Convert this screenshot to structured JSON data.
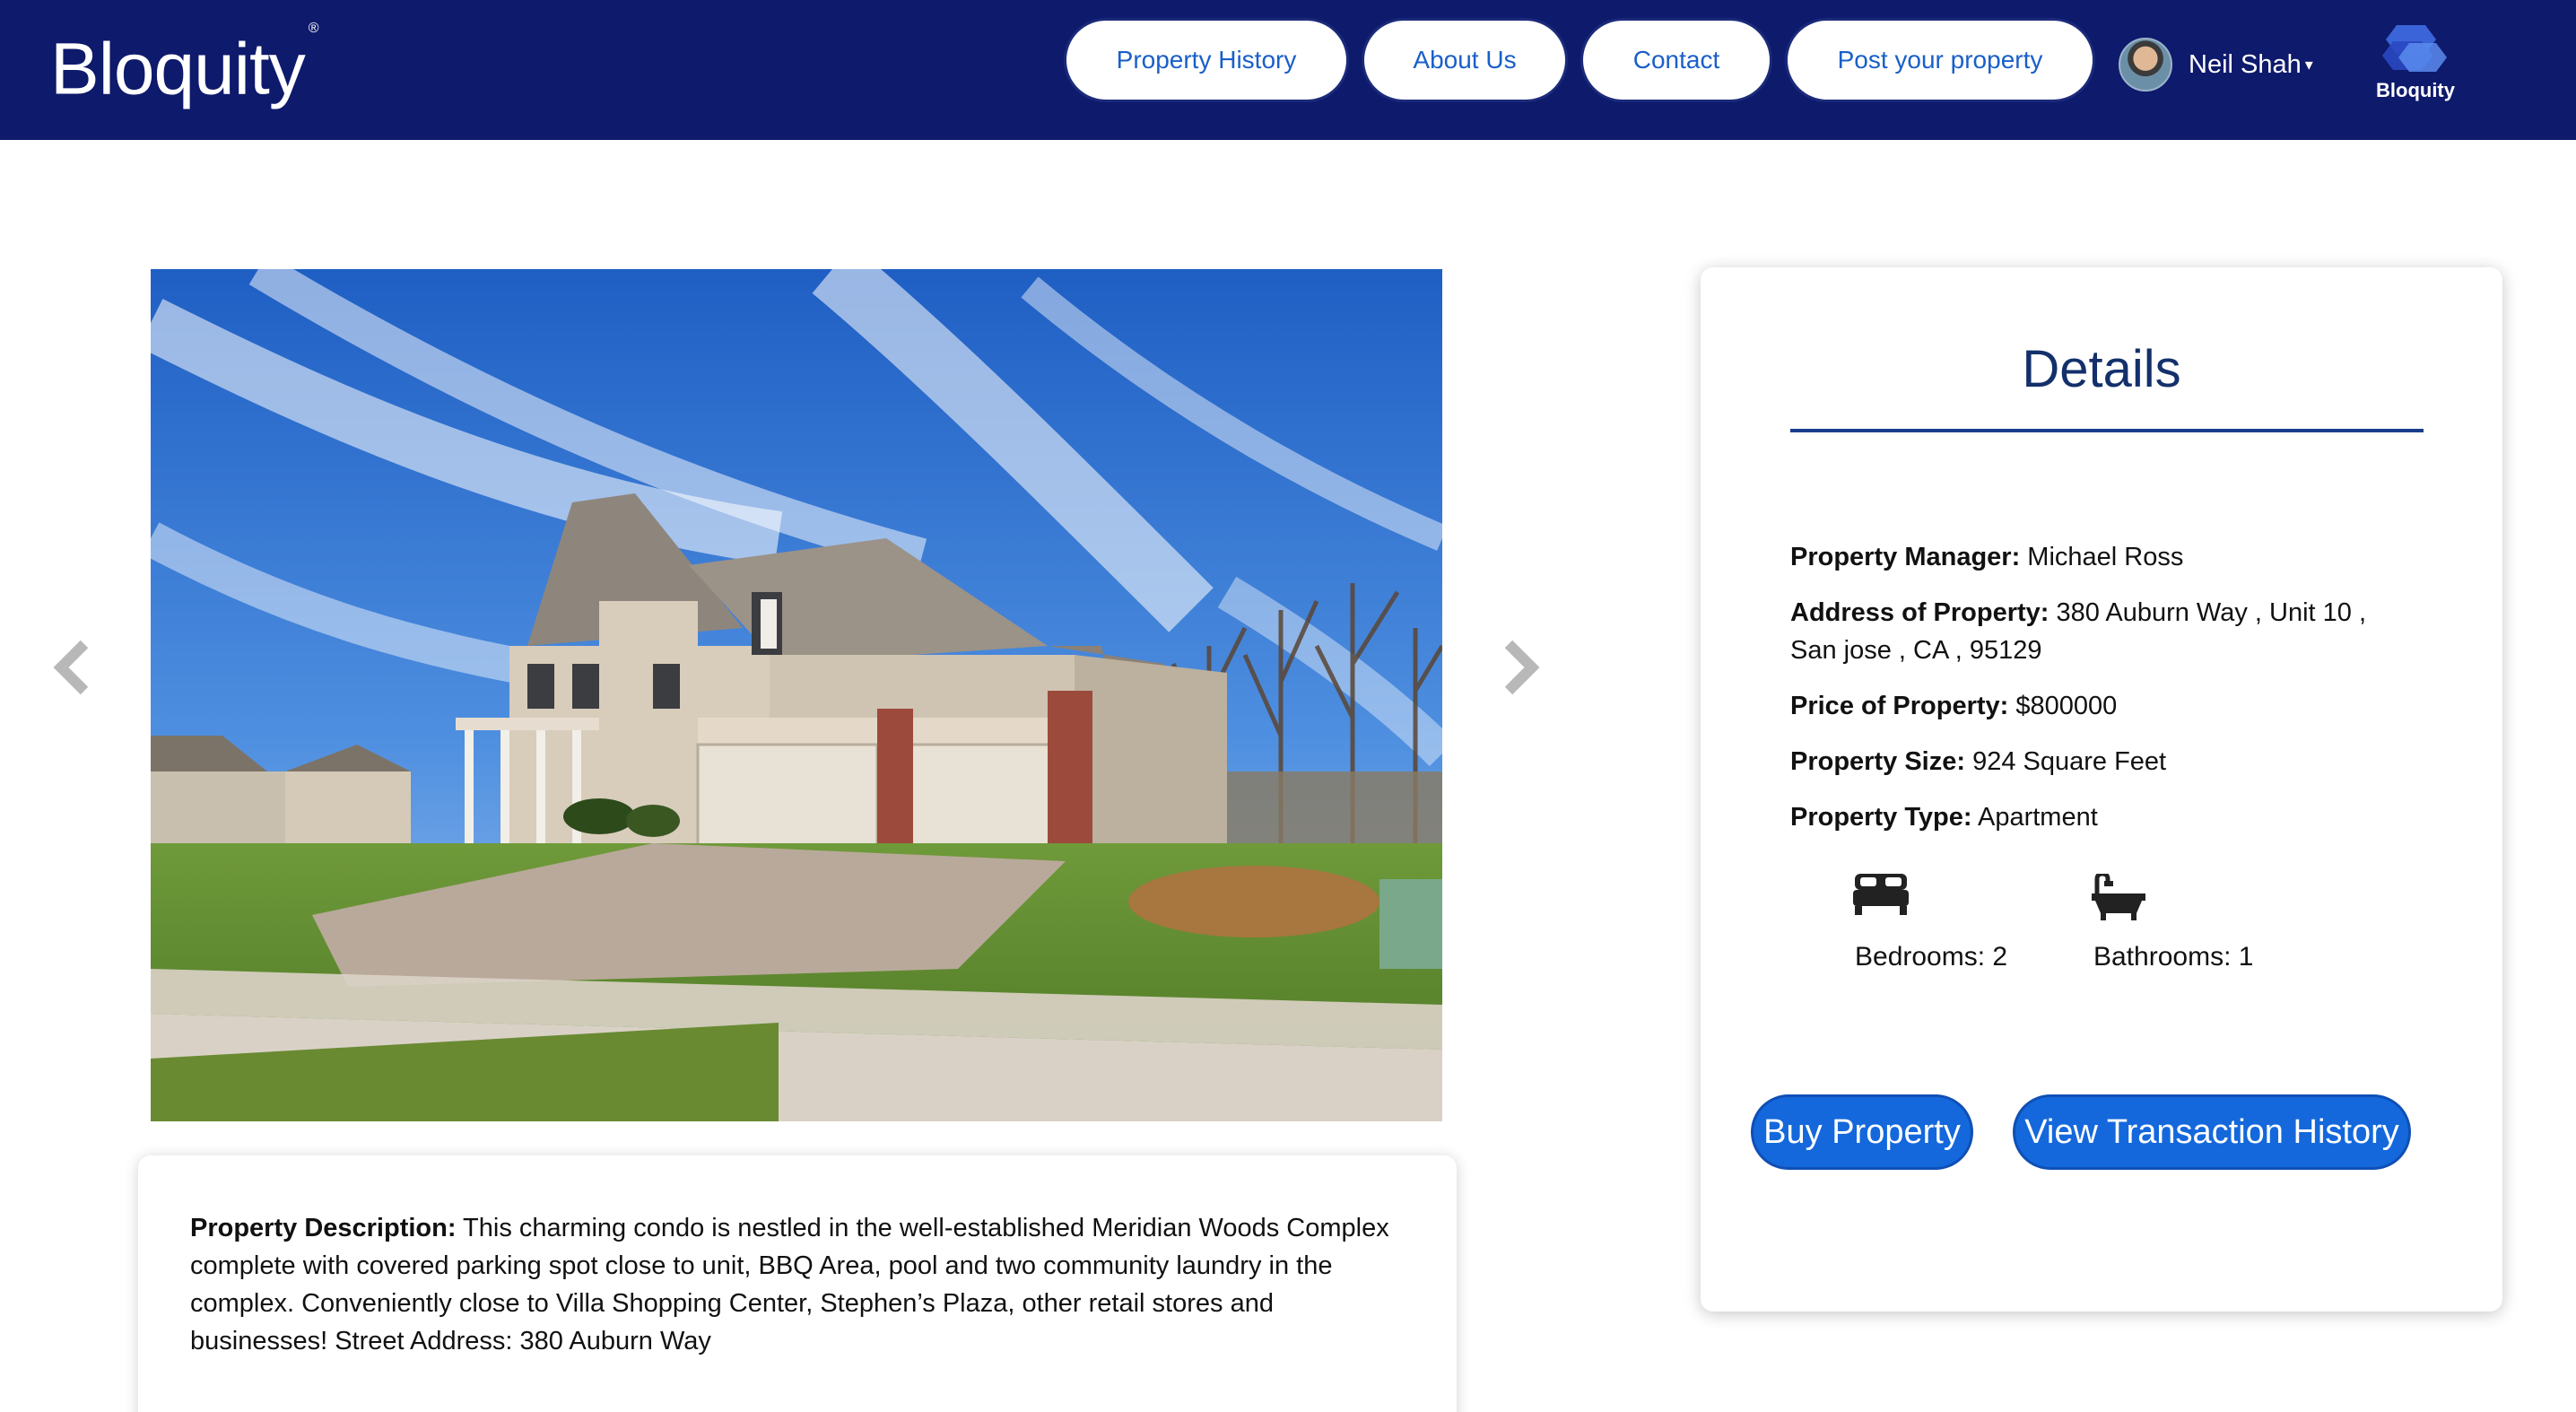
{
  "brand": {
    "name": "Bloquity",
    "mark": "®"
  },
  "nav": [
    {
      "label": "Property History"
    },
    {
      "label": "About Us"
    },
    {
      "label": "Contact"
    },
    {
      "label": "Post your property"
    }
  ],
  "user": {
    "name": "Neil Shah",
    "caret": "▾"
  },
  "logo_mark": {
    "text": "Bloquity"
  },
  "carousel": {
    "prev_icon": "chevron-left-icon",
    "next_icon": "chevron-right-icon",
    "image": "house-photo"
  },
  "description": {
    "label": "Property Description:",
    "text": "This charming condo is nestled in the well-established Meridian Woods Complex complete with covered parking spot close to unit, BBQ Area, pool and two community laundry in the complex. Conveniently close to Villa Shopping Center, Stephen’s Plaza, other retail stores and businesses! Street Address: 380 Auburn Way"
  },
  "details": {
    "title": "Details",
    "manager_label": "Property Manager:",
    "manager": "Michael Ross",
    "address_label": "Address of Property:",
    "address": "380 Auburn Way , Unit 10 , San jose , CA , 95129",
    "price_label": "Price of Property:",
    "price": "$800000",
    "size_label": "Property Size:",
    "size": "924 Square Feet",
    "type_label": "Property Type:",
    "type": "Apartment",
    "bedrooms": "Bedrooms: 2",
    "bathrooms": "Bathrooms: 1"
  },
  "actions": {
    "buy": "Buy Property",
    "history": "View Transaction History"
  },
  "colors": {
    "navbar": "#0e1a6b",
    "accent": "#1468dc",
    "link": "#1a5fc8",
    "title": "#13306b"
  }
}
